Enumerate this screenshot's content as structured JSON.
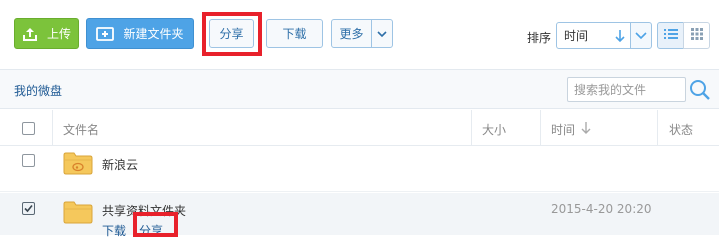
{
  "toolbar": {
    "upload": "上传",
    "new_folder": "新建文件夹",
    "share": "分享",
    "download": "下载",
    "more": "更多",
    "sort_label": "排序",
    "sort_value": "时间"
  },
  "breadcrumb": {
    "current": "我的微盘"
  },
  "search": {
    "placeholder": "搜索我的文件"
  },
  "table": {
    "columns": [
      "文件名",
      "大小",
      "时间",
      "状态"
    ],
    "rows": [
      {
        "name": "新浪云",
        "checked": false,
        "time": ""
      },
      {
        "name": "共享资料文件夹",
        "checked": true,
        "time": "2015-4-20 20:20",
        "actions": [
          "下载",
          "分享"
        ]
      }
    ]
  },
  "colors": {
    "upload_green": "#7cc33b",
    "newfolder_blue": "#4ea3e6",
    "link_blue": "#1f5a94",
    "highlight_red": "#e8212b",
    "folder_yellow": "#f5c85c"
  }
}
